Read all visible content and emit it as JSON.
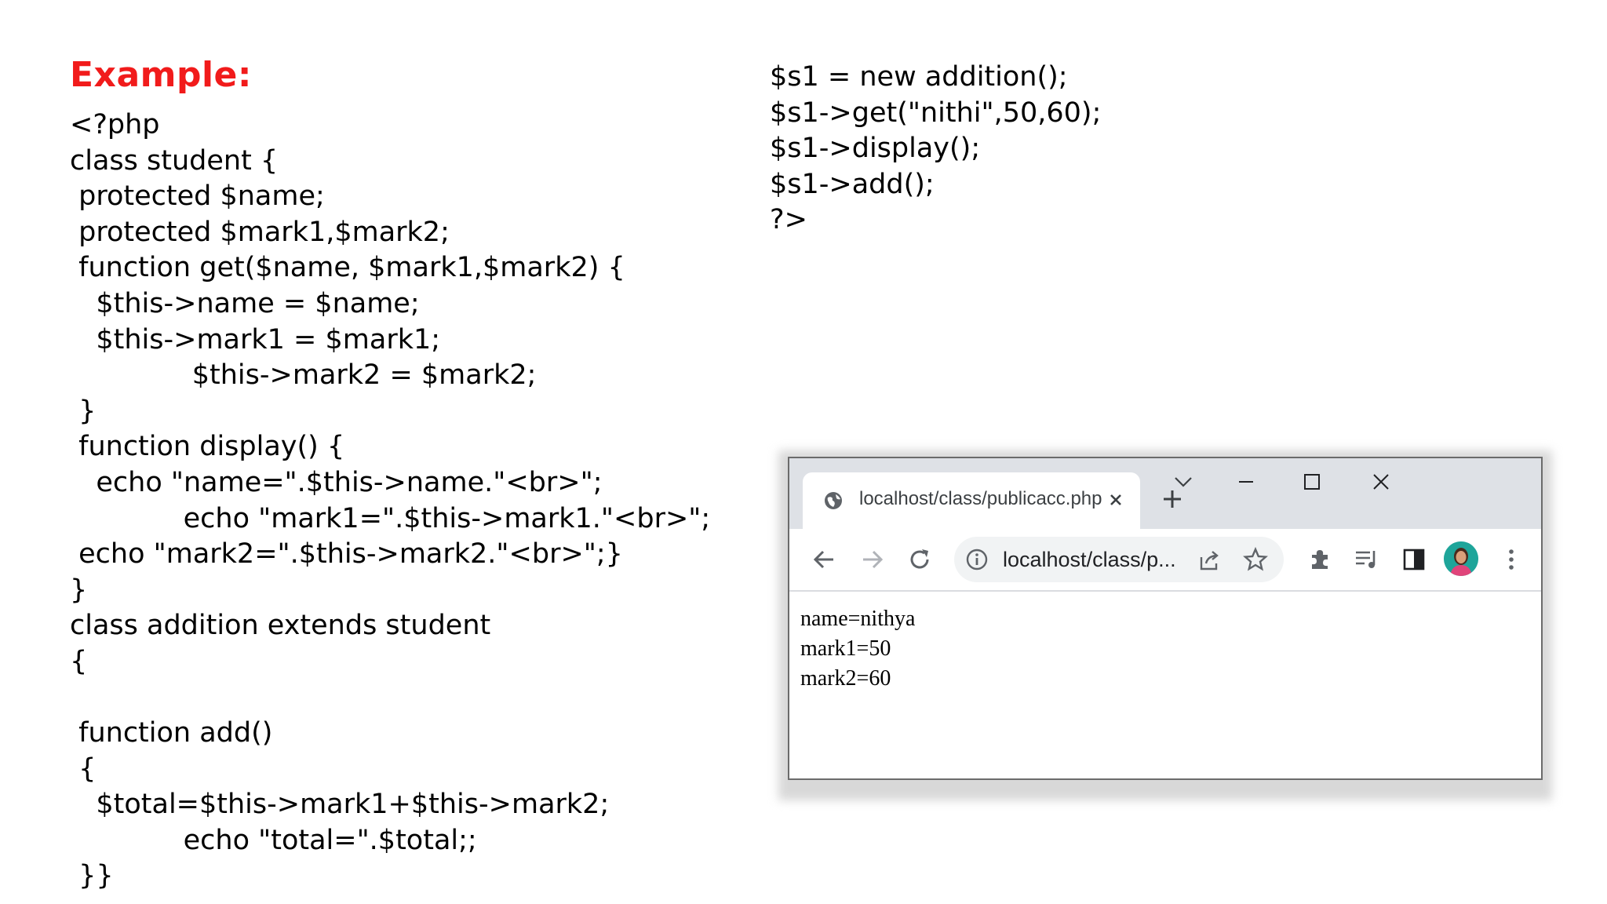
{
  "slide": {
    "heading": "Example:",
    "code_left": [
      "<?php",
      "class student {",
      " protected $name;",
      " protected $mark1,$mark2;",
      " function get($name, $mark1,$mark2) {",
      "   $this->name = $name;",
      "   $this->mark1 = $mark1;",
      "              $this->mark2 = $mark2;",
      " }",
      " function display() {",
      "   echo \"name=\".$this->name.\"<br>\";",
      "             echo \"mark1=\".$this->mark1.\"<br>\";",
      " echo \"mark2=\".$this->mark2.\"<br>\";}",
      "}",
      "class addition extends student",
      "{",
      "",
      " function add()",
      " {",
      "   $total=$this->mark1+$this->mark2;",
      "             echo \"total=\".$total;;",
      " }}"
    ],
    "code_right": [
      "$s1 = new addition();",
      "$s1->get(\"nithi\",50,60);",
      "$s1->display();",
      "$s1->add();",
      "?>"
    ]
  },
  "browser": {
    "tab_title": "localhost/class/publicacc.php",
    "address_text": "localhost/class/p...",
    "page_output": [
      "name=nithya",
      "mark1=50",
      "mark2=60"
    ],
    "icons": {
      "favicon": "globe-icon",
      "tab_close": "close-icon",
      "new_tab": "plus-icon",
      "tab_search": "chevron-down-icon",
      "minimize": "minimize-icon",
      "maximize": "maximize-icon",
      "close_window": "close-icon",
      "back": "arrow-left-icon",
      "forward": "arrow-right-icon",
      "reload": "reload-icon",
      "site_info": "info-icon",
      "share": "share-icon",
      "bookmark": "star-icon",
      "extensions": "puzzle-icon",
      "media": "media-control-icon",
      "side_panel": "side-panel-icon",
      "profile": "avatar",
      "menu": "kebab-menu-icon"
    },
    "colors": {
      "heading": "#f11b1b",
      "tabstrip": "#dee1e6",
      "omnibox": "#f1f3f4",
      "avatar": "#1ea59a"
    }
  }
}
